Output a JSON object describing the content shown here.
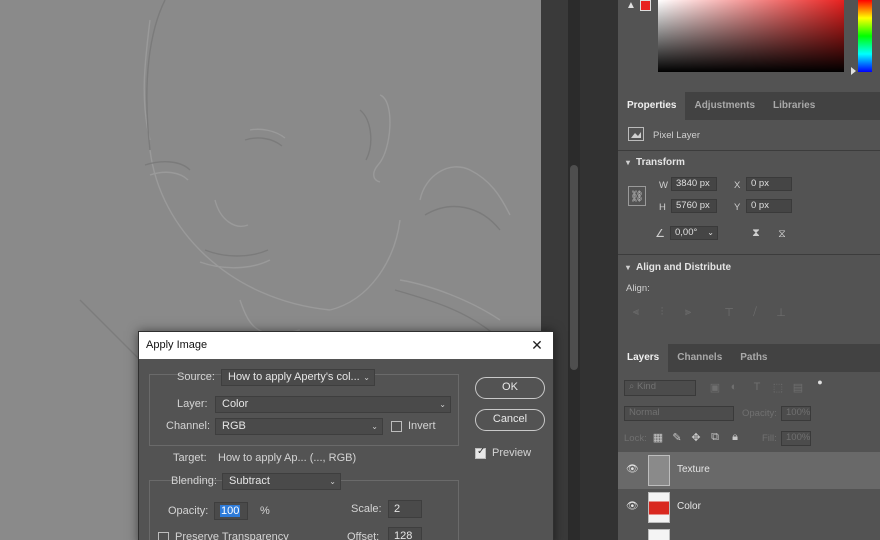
{
  "colors": {
    "accent_red": "#e8211f",
    "selection_blue": "#2e7bd8",
    "panel_bg": "#535353",
    "tab_bar_bg": "#424242"
  },
  "color_panel": {
    "warning_icon": "warning-icon",
    "foreground_swatch": "#e8211f"
  },
  "properties_tabs": [
    "Properties",
    "Adjustments",
    "Libraries"
  ],
  "properties": {
    "layer_type": "Pixel Layer",
    "transform": {
      "title": "Transform",
      "w_label": "W",
      "w_value": "3840 px",
      "x_label": "X",
      "x_value": "0 px",
      "h_label": "H",
      "h_value": "5760 px",
      "y_label": "Y",
      "y_value": "0 px",
      "angle_value": "0,00°"
    },
    "align": {
      "title": "Align and Distribute",
      "align_label": "Align:"
    }
  },
  "layers_tabs": [
    "Layers",
    "Channels",
    "Paths"
  ],
  "layers": {
    "kind_placeholder": "Kind",
    "blend_mode": "Normal",
    "opacity_label": "Opacity:",
    "opacity_value": "100%",
    "lock_label": "Lock:",
    "fill_label": "Fill:",
    "fill_value": "100%",
    "items": [
      {
        "name": "Texture",
        "selected": true
      },
      {
        "name": "Color",
        "selected": false
      }
    ]
  },
  "dialog": {
    "title": "Apply Image",
    "source_label": "Source:",
    "source_value": "How to apply Aperty's col...",
    "layer_label": "Layer:",
    "layer_value": "Color",
    "channel_label": "Channel:",
    "channel_value": "RGB",
    "invert_label": "Invert",
    "invert_checked": false,
    "target_label": "Target:",
    "target_value": "How to apply Ap... (..., RGB)",
    "blending_label": "Blending:",
    "blending_value": "Subtract",
    "opacity_label": "Opacity:",
    "opacity_value": "100",
    "opacity_unit": "%",
    "scale_label": "Scale:",
    "scale_value": "2",
    "offset_label": "Offset:",
    "offset_value": "128",
    "preserve_label": "Preserve Transparency",
    "ok_label": "OK",
    "cancel_label": "Cancel",
    "preview_label": "Preview",
    "preview_checked": true
  }
}
